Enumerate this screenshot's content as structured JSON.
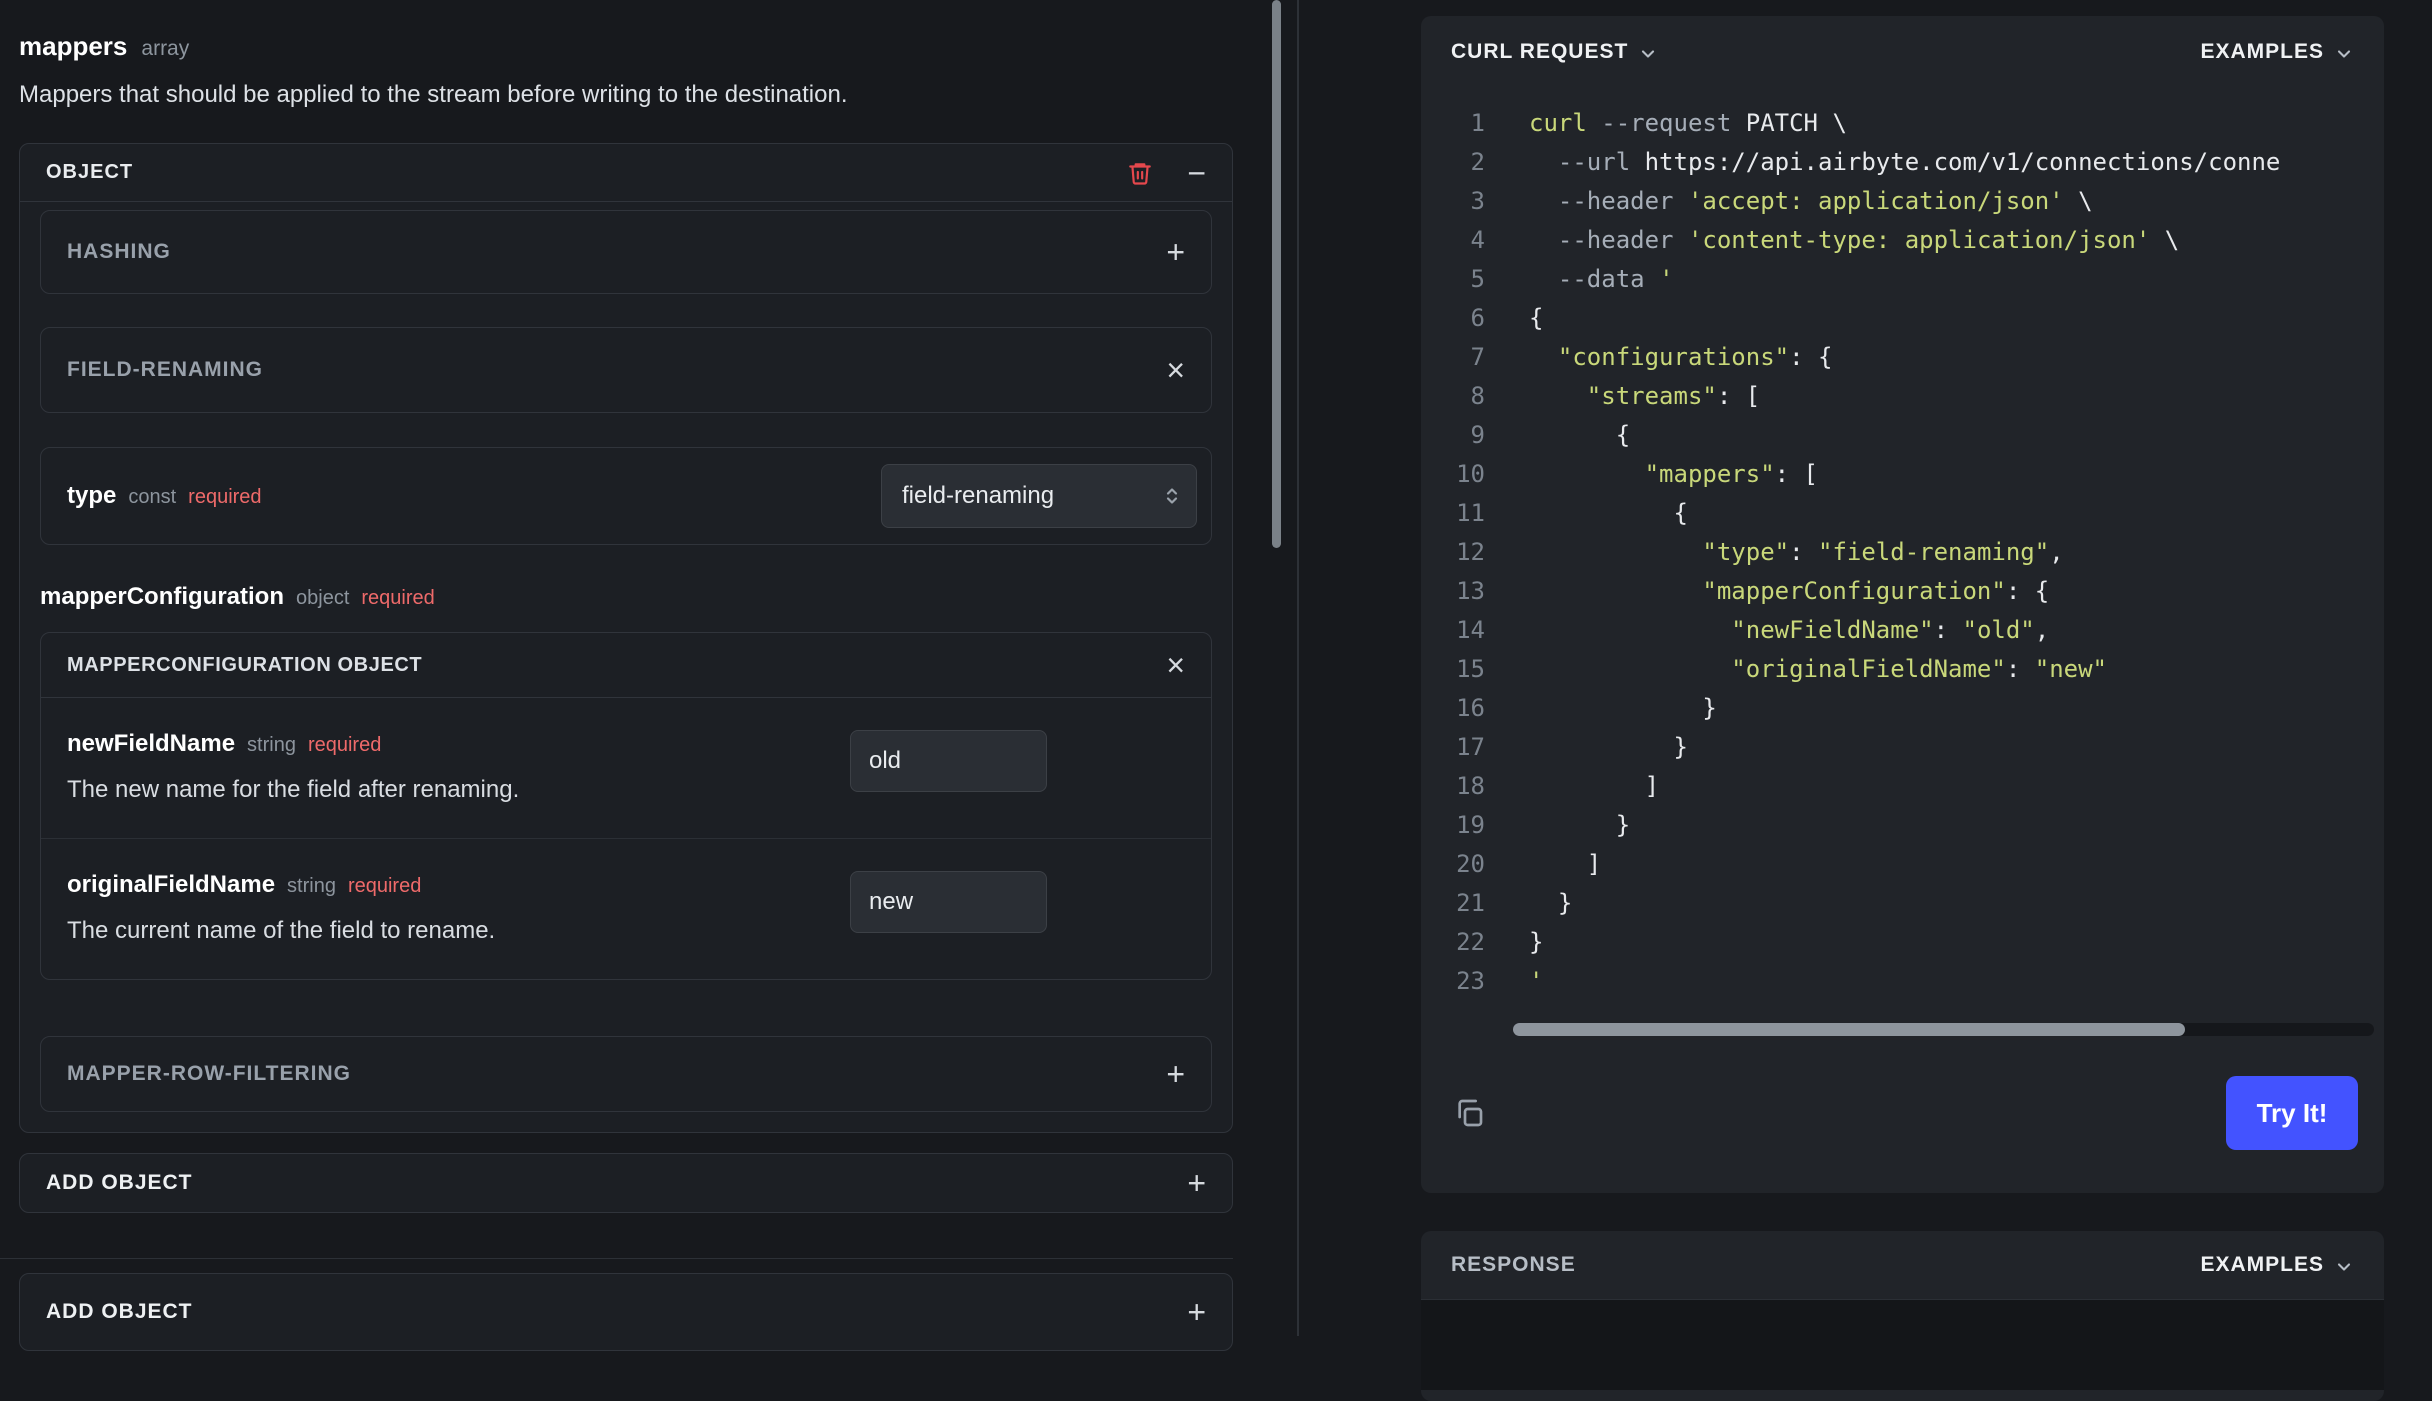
{
  "left": {
    "field": {
      "name": "mappers",
      "type": "array"
    },
    "description": "Mappers that should be applied to the stream before writing to the destination.",
    "object_panel": {
      "title": "OBJECT"
    },
    "hashing": {
      "title": "HASHING"
    },
    "field_renaming": {
      "title": "FIELD-RENAMING",
      "type_row": {
        "name": "type",
        "kind": "const",
        "required": "required",
        "value": "field-renaming"
      },
      "mapper_configuration": {
        "name": "mapperConfiguration",
        "kind": "object",
        "required": "required",
        "panel_title": "MAPPERCONFIGURATION OBJECT",
        "fields": [
          {
            "name": "newFieldName",
            "kind": "string",
            "required": "required",
            "value": "old",
            "description": "The new name for the field after renaming."
          },
          {
            "name": "originalFieldName",
            "kind": "string",
            "required": "required",
            "value": "new",
            "description": "The current name of the field to rename."
          }
        ]
      }
    },
    "row_filtering": {
      "title": "MAPPER-ROW-FILTERING"
    },
    "add_object": {
      "label": "ADD OBJECT"
    },
    "add_object_bottom": {
      "label": "ADD OBJECT"
    }
  },
  "right": {
    "curl": {
      "title": "CURL REQUEST",
      "examples": "EXAMPLES",
      "try_it": "Try It!"
    },
    "response": {
      "title": "RESPONSE",
      "examples": "EXAMPLES"
    },
    "code": {
      "lines": [
        [
          [
            "s",
            "curl"
          ],
          [
            "p",
            " "
          ],
          [
            "o",
            "--request"
          ],
          [
            "p",
            " PATCH \\"
          ]
        ],
        [
          [
            "p",
            "  "
          ],
          [
            "o",
            "--url"
          ],
          [
            "p",
            " https://api.airbyte.com/v1/connections/conne"
          ]
        ],
        [
          [
            "p",
            "  "
          ],
          [
            "o",
            "--header"
          ],
          [
            "p",
            " "
          ],
          [
            "s",
            "'accept: application/json'"
          ],
          [
            "p",
            " \\"
          ]
        ],
        [
          [
            "p",
            "  "
          ],
          [
            "o",
            "--header"
          ],
          [
            "p",
            " "
          ],
          [
            "s",
            "'content-type: application/json'"
          ],
          [
            "p",
            " \\"
          ]
        ],
        [
          [
            "p",
            "  "
          ],
          [
            "o",
            "--data"
          ],
          [
            "p",
            " "
          ],
          [
            "s",
            "'"
          ]
        ],
        [
          [
            "p",
            "{"
          ]
        ],
        [
          [
            "p",
            "  "
          ],
          [
            "s",
            "\"configurations\""
          ],
          [
            "p",
            ": {"
          ]
        ],
        [
          [
            "p",
            "    "
          ],
          [
            "s",
            "\"streams\""
          ],
          [
            "p",
            ": ["
          ]
        ],
        [
          [
            "p",
            "      {"
          ]
        ],
        [
          [
            "p",
            "        "
          ],
          [
            "s",
            "\"mappers\""
          ],
          [
            "p",
            ": ["
          ]
        ],
        [
          [
            "p",
            "          {"
          ]
        ],
        [
          [
            "p",
            "            "
          ],
          [
            "s",
            "\"type\""
          ],
          [
            "p",
            ": "
          ],
          [
            "s",
            "\"field-renaming\""
          ],
          [
            "p",
            ","
          ]
        ],
        [
          [
            "p",
            "            "
          ],
          [
            "s",
            "\"mapperConfiguration\""
          ],
          [
            "p",
            ": {"
          ]
        ],
        [
          [
            "p",
            "              "
          ],
          [
            "s",
            "\"newFieldName\""
          ],
          [
            "p",
            ": "
          ],
          [
            "s",
            "\"old\""
          ],
          [
            "p",
            ","
          ]
        ],
        [
          [
            "p",
            "              "
          ],
          [
            "s",
            "\"originalFieldName\""
          ],
          [
            "p",
            ": "
          ],
          [
            "s",
            "\"new\""
          ]
        ],
        [
          [
            "p",
            "            }"
          ]
        ],
        [
          [
            "p",
            "          }"
          ]
        ],
        [
          [
            "p",
            "        ]"
          ]
        ],
        [
          [
            "p",
            "      }"
          ]
        ],
        [
          [
            "p",
            "    ]"
          ]
        ],
        [
          [
            "p",
            "  }"
          ]
        ],
        [
          [
            "p",
            "}"
          ]
        ],
        [
          [
            "s",
            "'"
          ]
        ]
      ]
    }
  },
  "icons": {
    "minus": "−",
    "plus": "+",
    "close": "×"
  },
  "colors": {
    "accent_blue": "#4353ff",
    "required_red": "#ee6a6a",
    "trash_red": "#e5484d",
    "code_string": "#c9d87a",
    "panel_bg": "#212429"
  }
}
